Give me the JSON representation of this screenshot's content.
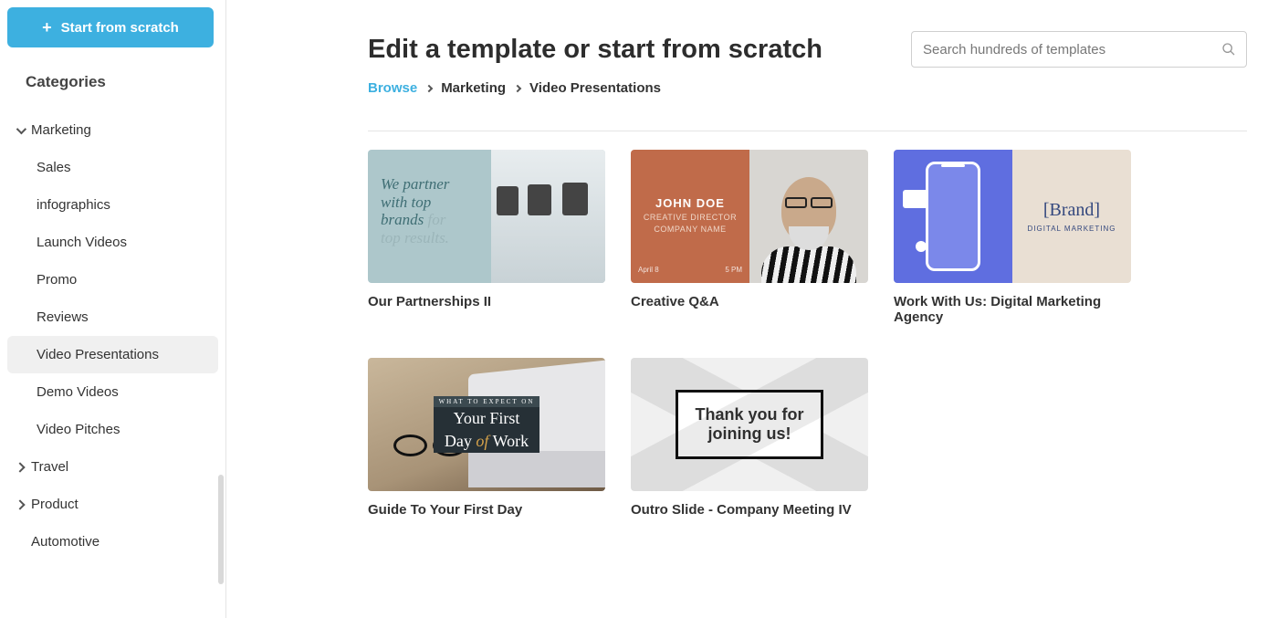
{
  "sidebar": {
    "start_label": "Start from scratch",
    "heading": "Categories",
    "items": [
      {
        "label": "Marketing",
        "expanded": true,
        "children": [
          {
            "label": "Sales"
          },
          {
            "label": "infographics"
          },
          {
            "label": "Launch Videos"
          },
          {
            "label": "Promo"
          },
          {
            "label": "Reviews"
          },
          {
            "label": "Video Presentations",
            "selected": true
          },
          {
            "label": "Demo Videos"
          },
          {
            "label": "Video Pitches"
          }
        ]
      },
      {
        "label": "Travel",
        "expanded": false
      },
      {
        "label": "Product",
        "expanded": false
      },
      {
        "label": "Automotive",
        "expanded": false
      }
    ]
  },
  "header": {
    "title": "Edit a template or start from scratch",
    "search_placeholder": "Search hundreds of templates"
  },
  "breadcrumb": {
    "root": "Browse",
    "level1": "Marketing",
    "level2": "Video Presentations"
  },
  "templates": [
    {
      "title": "Our Partnerships II",
      "thumb": {
        "line1_a": "We partner",
        "line1_b": "with top",
        "line2_a": "brands",
        "line2_b": "for",
        "line3": "top results."
      }
    },
    {
      "title": "Creative Q&A",
      "thumb": {
        "name": "JOHN DOE",
        "role1": "CREATIVE DIRECTOR",
        "role2": "COMPANY NAME",
        "date": "April 8",
        "time": "5 PM"
      }
    },
    {
      "title": "Work With Us: Digital Marketing Agency",
      "thumb": {
        "brand": "[Brand]",
        "sub": "DIGITAL MARKETING"
      }
    },
    {
      "title": "Guide To Your First Day",
      "thumb": {
        "top": "WHAT TO EXPECT ON",
        "line1": "Your First",
        "line2a": "Day",
        "line2b": "of",
        "line2c": "Work"
      }
    },
    {
      "title": "Outro Slide - Company Meeting IV",
      "thumb": {
        "line1": "Thank you for",
        "line2": "joining us!"
      }
    }
  ]
}
